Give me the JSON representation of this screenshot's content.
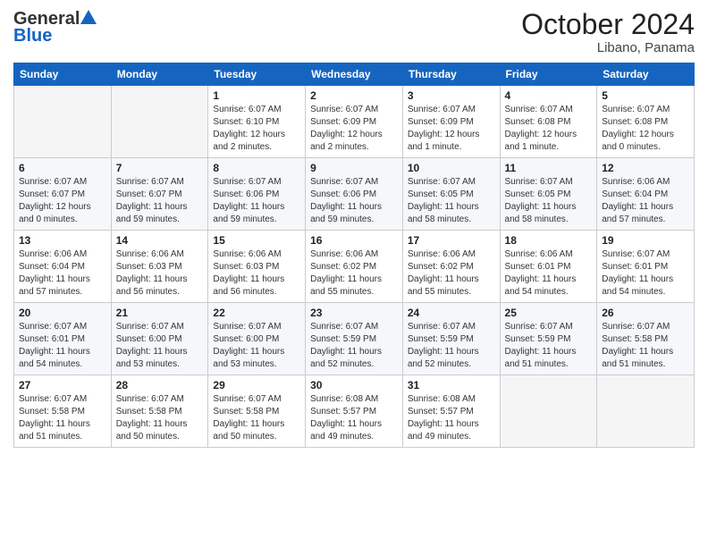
{
  "header": {
    "logo_general": "General",
    "logo_blue": "Blue",
    "month_title": "October 2024",
    "location": "Libano, Panama"
  },
  "days_of_week": [
    "Sunday",
    "Monday",
    "Tuesday",
    "Wednesday",
    "Thursday",
    "Friday",
    "Saturday"
  ],
  "weeks": [
    [
      {
        "day": "",
        "info": ""
      },
      {
        "day": "",
        "info": ""
      },
      {
        "day": "1",
        "info": "Sunrise: 6:07 AM\nSunset: 6:10 PM\nDaylight: 12 hours\nand 2 minutes."
      },
      {
        "day": "2",
        "info": "Sunrise: 6:07 AM\nSunset: 6:09 PM\nDaylight: 12 hours\nand 2 minutes."
      },
      {
        "day": "3",
        "info": "Sunrise: 6:07 AM\nSunset: 6:09 PM\nDaylight: 12 hours\nand 1 minute."
      },
      {
        "day": "4",
        "info": "Sunrise: 6:07 AM\nSunset: 6:08 PM\nDaylight: 12 hours\nand 1 minute."
      },
      {
        "day": "5",
        "info": "Sunrise: 6:07 AM\nSunset: 6:08 PM\nDaylight: 12 hours\nand 0 minutes."
      }
    ],
    [
      {
        "day": "6",
        "info": "Sunrise: 6:07 AM\nSunset: 6:07 PM\nDaylight: 12 hours\nand 0 minutes."
      },
      {
        "day": "7",
        "info": "Sunrise: 6:07 AM\nSunset: 6:07 PM\nDaylight: 11 hours\nand 59 minutes."
      },
      {
        "day": "8",
        "info": "Sunrise: 6:07 AM\nSunset: 6:06 PM\nDaylight: 11 hours\nand 59 minutes."
      },
      {
        "day": "9",
        "info": "Sunrise: 6:07 AM\nSunset: 6:06 PM\nDaylight: 11 hours\nand 59 minutes."
      },
      {
        "day": "10",
        "info": "Sunrise: 6:07 AM\nSunset: 6:05 PM\nDaylight: 11 hours\nand 58 minutes."
      },
      {
        "day": "11",
        "info": "Sunrise: 6:07 AM\nSunset: 6:05 PM\nDaylight: 11 hours\nand 58 minutes."
      },
      {
        "day": "12",
        "info": "Sunrise: 6:06 AM\nSunset: 6:04 PM\nDaylight: 11 hours\nand 57 minutes."
      }
    ],
    [
      {
        "day": "13",
        "info": "Sunrise: 6:06 AM\nSunset: 6:04 PM\nDaylight: 11 hours\nand 57 minutes."
      },
      {
        "day": "14",
        "info": "Sunrise: 6:06 AM\nSunset: 6:03 PM\nDaylight: 11 hours\nand 56 minutes."
      },
      {
        "day": "15",
        "info": "Sunrise: 6:06 AM\nSunset: 6:03 PM\nDaylight: 11 hours\nand 56 minutes."
      },
      {
        "day": "16",
        "info": "Sunrise: 6:06 AM\nSunset: 6:02 PM\nDaylight: 11 hours\nand 55 minutes."
      },
      {
        "day": "17",
        "info": "Sunrise: 6:06 AM\nSunset: 6:02 PM\nDaylight: 11 hours\nand 55 minutes."
      },
      {
        "day": "18",
        "info": "Sunrise: 6:06 AM\nSunset: 6:01 PM\nDaylight: 11 hours\nand 54 minutes."
      },
      {
        "day": "19",
        "info": "Sunrise: 6:07 AM\nSunset: 6:01 PM\nDaylight: 11 hours\nand 54 minutes."
      }
    ],
    [
      {
        "day": "20",
        "info": "Sunrise: 6:07 AM\nSunset: 6:01 PM\nDaylight: 11 hours\nand 54 minutes."
      },
      {
        "day": "21",
        "info": "Sunrise: 6:07 AM\nSunset: 6:00 PM\nDaylight: 11 hours\nand 53 minutes."
      },
      {
        "day": "22",
        "info": "Sunrise: 6:07 AM\nSunset: 6:00 PM\nDaylight: 11 hours\nand 53 minutes."
      },
      {
        "day": "23",
        "info": "Sunrise: 6:07 AM\nSunset: 5:59 PM\nDaylight: 11 hours\nand 52 minutes."
      },
      {
        "day": "24",
        "info": "Sunrise: 6:07 AM\nSunset: 5:59 PM\nDaylight: 11 hours\nand 52 minutes."
      },
      {
        "day": "25",
        "info": "Sunrise: 6:07 AM\nSunset: 5:59 PM\nDaylight: 11 hours\nand 51 minutes."
      },
      {
        "day": "26",
        "info": "Sunrise: 6:07 AM\nSunset: 5:58 PM\nDaylight: 11 hours\nand 51 minutes."
      }
    ],
    [
      {
        "day": "27",
        "info": "Sunrise: 6:07 AM\nSunset: 5:58 PM\nDaylight: 11 hours\nand 51 minutes."
      },
      {
        "day": "28",
        "info": "Sunrise: 6:07 AM\nSunset: 5:58 PM\nDaylight: 11 hours\nand 50 minutes."
      },
      {
        "day": "29",
        "info": "Sunrise: 6:07 AM\nSunset: 5:58 PM\nDaylight: 11 hours\nand 50 minutes."
      },
      {
        "day": "30",
        "info": "Sunrise: 6:08 AM\nSunset: 5:57 PM\nDaylight: 11 hours\nand 49 minutes."
      },
      {
        "day": "31",
        "info": "Sunrise: 6:08 AM\nSunset: 5:57 PM\nDaylight: 11 hours\nand 49 minutes."
      },
      {
        "day": "",
        "info": ""
      },
      {
        "day": "",
        "info": ""
      }
    ]
  ]
}
